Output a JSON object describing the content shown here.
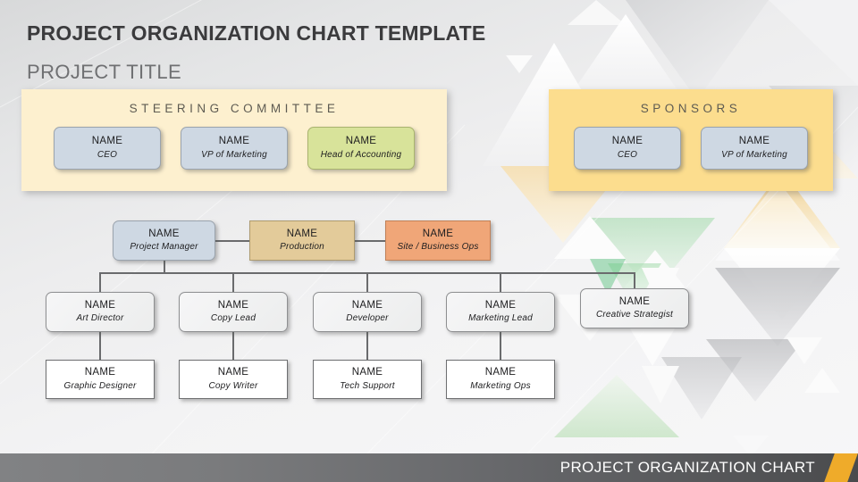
{
  "header": {
    "title": "PROJECT ORGANIZATION CHART TEMPLATE",
    "subtitle": "PROJECT TITLE"
  },
  "footer": {
    "label": "PROJECT ORGANIZATION CHART",
    "accent_color": "#efab2a"
  },
  "panels": {
    "steering": {
      "title": "STEERING COMMITTEE",
      "background": "#fdf0cf",
      "members": [
        {
          "name": "NAME",
          "role": "CEO",
          "color": "#ced8e3"
        },
        {
          "name": "NAME",
          "role": "VP of Marketing",
          "color": "#ced8e3"
        },
        {
          "name": "NAME",
          "role": "Head of Accounting",
          "color": "#d8e39a"
        }
      ]
    },
    "sponsors": {
      "title": "SPONSORS",
      "background": "#fcdd8e",
      "members": [
        {
          "name": "NAME",
          "role": "CEO",
          "color": "#ced8e3"
        },
        {
          "name": "NAME",
          "role": "VP of Marketing",
          "color": "#ced8e3"
        }
      ]
    }
  },
  "chart_data": {
    "type": "diagram",
    "title": "Project Organization Chart",
    "tier2": [
      {
        "name": "NAME",
        "role": "Project Manager",
        "color": "#ced8e3"
      },
      {
        "name": "NAME",
        "role": "Production",
        "color": "#e3cb9a"
      },
      {
        "name": "NAME",
        "role": "Site / Business Ops",
        "color": "#f0a678"
      }
    ],
    "tier3": [
      {
        "name": "NAME",
        "role": "Art Director"
      },
      {
        "name": "NAME",
        "role": "Copy Lead"
      },
      {
        "name": "NAME",
        "role": "Developer"
      },
      {
        "name": "NAME",
        "role": "Marketing Lead"
      },
      {
        "name": "NAME",
        "role": "Creative Strategist"
      }
    ],
    "tier4": [
      {
        "name": "NAME",
        "role": "Graphic Designer"
      },
      {
        "name": "NAME",
        "role": "Copy Writer"
      },
      {
        "name": "NAME",
        "role": "Tech Support"
      },
      {
        "name": "NAME",
        "role": "Marketing Ops"
      }
    ]
  }
}
